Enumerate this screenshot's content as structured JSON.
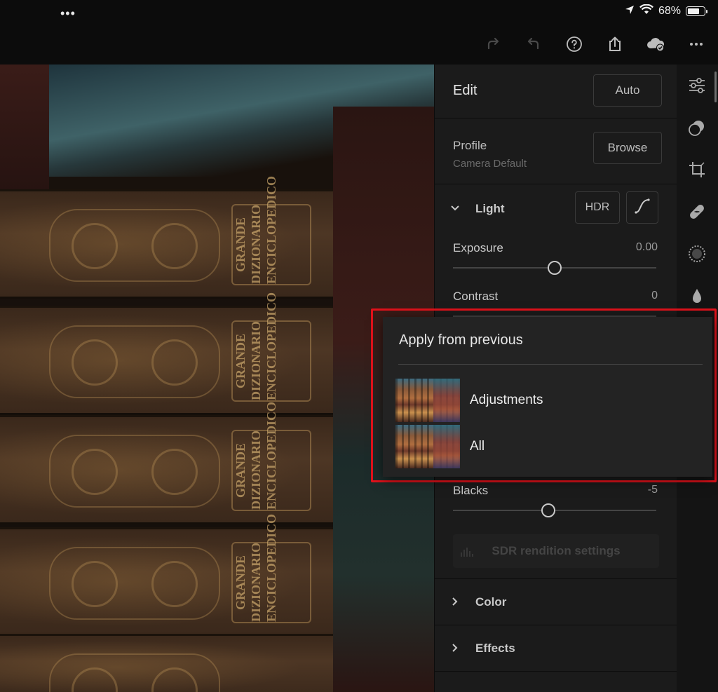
{
  "status_bar": {
    "dots": "•••",
    "battery_percent": "68%"
  },
  "toolbar": {
    "icons": [
      "redo-icon",
      "undo-icon",
      "help-icon",
      "share-icon",
      "cloud-sync-icon",
      "more-icon"
    ]
  },
  "photo": {
    "spines": [
      {
        "title": "GRANDE DIZIONARIO ENCICLOPEDICO"
      },
      {
        "title": "GRANDE DIZIONARIO ENCICLOPEDICO"
      },
      {
        "title": "GRANDE DIZIONARIO ENCICLOPEDICO"
      },
      {
        "title": "GRANDE DIZIONARIO ENCICLOPEDICO"
      }
    ]
  },
  "panel": {
    "title": "Edit",
    "auto_label": "Auto",
    "profile": {
      "label": "Profile",
      "value": "Camera Default",
      "browse_label": "Browse"
    },
    "light": {
      "label": "Light",
      "hdr_label": "HDR",
      "exposure": {
        "label": "Exposure",
        "value": "0.00",
        "position": 0.5
      },
      "contrast": {
        "label": "Contrast",
        "value": "0"
      },
      "blacks": {
        "label": "Blacks",
        "value": "-5",
        "position": 0.47
      },
      "sdr_label": "SDR rendition settings"
    },
    "color_label": "Color",
    "effects_label": "Effects"
  },
  "tools": [
    "adjust-sliders-icon",
    "presets-icon",
    "crop-icon",
    "healing-icon",
    "masking-icon",
    "color-drop-icon"
  ],
  "popup": {
    "title": "Apply from previous",
    "items": [
      {
        "label": "Adjustments"
      },
      {
        "label": "All"
      }
    ],
    "highlight_color": "#e3121b"
  }
}
